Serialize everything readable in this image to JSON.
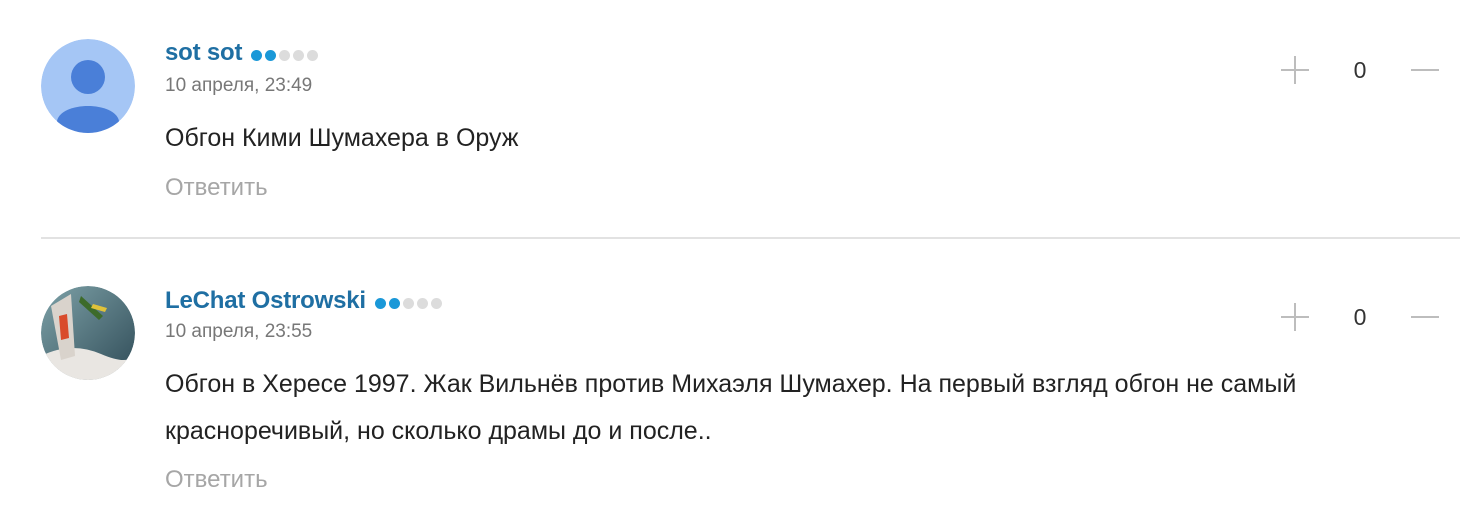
{
  "comments": [
    {
      "author": "sot sot",
      "rating_level": 2,
      "rating_max": 5,
      "timestamp": "10 апреля, 23:49",
      "text": "Обгон Кими Шумахера в Оруж",
      "reply_label": "Ответить",
      "votes": "0",
      "avatar": "default-user-avatar"
    },
    {
      "author": "LeChat Ostrowski",
      "rating_level": 2,
      "rating_max": 5,
      "timestamp": "10 апреля, 23:55",
      "text": "Обгон в Хересе 1997. Жак Вильнёв против Михаэля Шумахер. На первый взгляд обгон не самый красноречивый, но сколько драмы до и после..",
      "reply_label": "Ответить",
      "votes": "0",
      "avatar": "photo-avatar"
    }
  ],
  "colors": {
    "author": "#1f6fa3",
    "dot_active": "#1a98d8",
    "dot_inactive": "#dcdcdc",
    "muted": "#a6a6a6"
  },
  "icons": {
    "upvote": "plus-icon",
    "downvote": "minus-icon"
  }
}
